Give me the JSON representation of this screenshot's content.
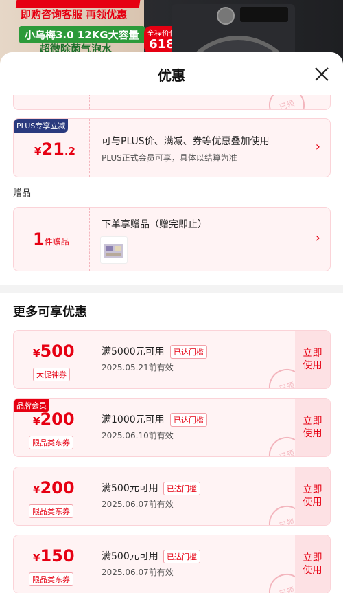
{
  "banner": {
    "line1": "即购咨询客服 再领优惠",
    "line2": "小乌梅3.0 12KG大容量",
    "line3": "超微除菌气泡水",
    "badge_top": "全程价保",
    "badge_num": "618"
  },
  "sheet": {
    "title": "优惠",
    "plus_card": {
      "tag": "PLUS专享立减",
      "currency": "¥",
      "amount_int": "21",
      "amount_dec": ".2",
      "title": "可与PLUS价、满减、券等优惠叠加使用",
      "subtitle": "PLUS正式会员可享，具体以结算为准"
    },
    "gift_label": "赠品",
    "gift_card": {
      "count": "1",
      "unit": "件赠品",
      "title": "下单享赠品（赠完即止）"
    },
    "more_title": "更多可享优惠",
    "stamp_text": "已领",
    "coupons": [
      {
        "amount": "500",
        "label": "大促神券",
        "requirement": "满5000元可用",
        "pill": "已达门槛",
        "date": "2025.05.21前有效",
        "use": "立即使用",
        "tag": ""
      },
      {
        "amount": "200",
        "label": "限品类东券",
        "requirement": "满1000元可用",
        "pill": "已达门槛",
        "date": "2025.06.10前有效",
        "use": "立即使用",
        "tag": "品牌会员"
      },
      {
        "amount": "200",
        "label": "限品类东券",
        "requirement": "满500元可用",
        "pill": "已达门槛",
        "date": "2025.06.07前有效",
        "use": "立即使用",
        "tag": ""
      },
      {
        "amount": "150",
        "label": "限品类东券",
        "requirement": "满500元可用",
        "pill": "已达门槛",
        "date": "2025.06.07前有效",
        "use": "立即使用",
        "tag": ""
      }
    ]
  },
  "colors": {
    "accent": "#e60012",
    "plus": "#2a3a7e",
    "card_bg": "#fff3f4"
  }
}
